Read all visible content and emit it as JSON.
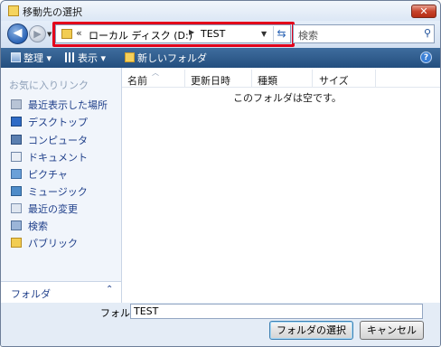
{
  "window": {
    "title": "移動先の選択",
    "close_label": "✕"
  },
  "navigation": {
    "address": {
      "overflow": "«",
      "segments": [
        "ローカル ディスク (D:)",
        "TEST"
      ]
    },
    "search_placeholder": "検索",
    "highlight_color": "#e3001b"
  },
  "toolbar": {
    "organize_label": "整理",
    "views_label": "表示",
    "new_folder_label": "新しいフォルダ",
    "help_label": "?"
  },
  "nav_pane": {
    "favorites_title": "お気に入りリンク",
    "items": [
      {
        "label": "最近表示した場所",
        "icon": "recent-places-icon"
      },
      {
        "label": "デスクトップ",
        "icon": "desktop-icon"
      },
      {
        "label": "コンピュータ",
        "icon": "computer-icon"
      },
      {
        "label": "ドキュメント",
        "icon": "documents-icon"
      },
      {
        "label": "ピクチャ",
        "icon": "pictures-icon"
      },
      {
        "label": "ミュージック",
        "icon": "music-icon"
      },
      {
        "label": "最近の変更",
        "icon": "recently-changed-icon"
      },
      {
        "label": "検索",
        "icon": "searches-icon"
      },
      {
        "label": "パブリック",
        "icon": "public-folder-icon"
      }
    ],
    "folders_label": "フォルダ",
    "folders_caret": "⌃"
  },
  "content": {
    "columns": [
      "名前",
      "更新日時",
      "種類",
      "サイズ"
    ],
    "empty_message": "このフォルダは空です。"
  },
  "footer": {
    "folder_label": "フォルダ:",
    "folder_value": "TEST",
    "select_button": "フォルダの選択",
    "cancel_button": "キャンセル"
  }
}
